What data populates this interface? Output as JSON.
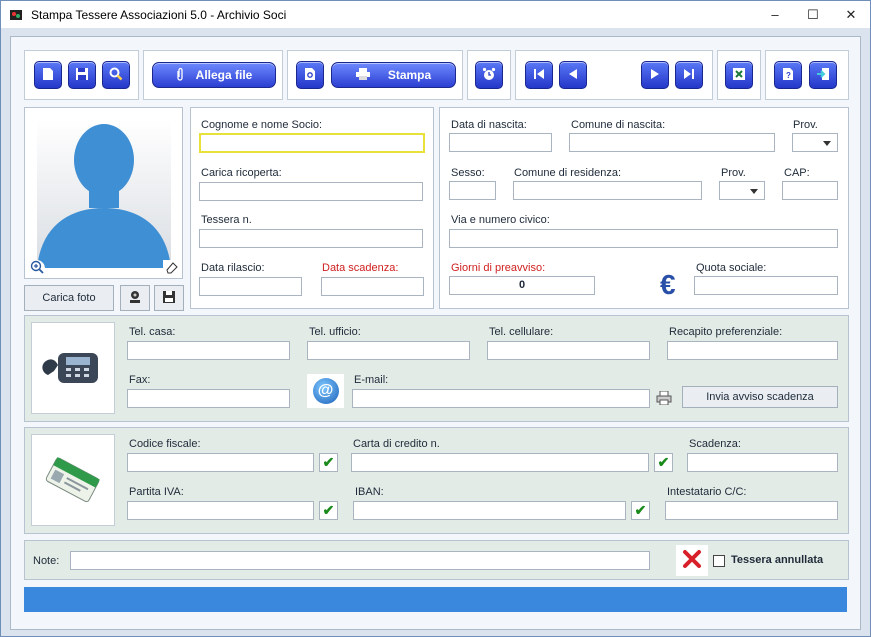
{
  "window": {
    "title": "Stampa Tessere Associazioni 5.0 - Archivio Soci",
    "minimize": "–",
    "maximize": "☐",
    "close": "✕"
  },
  "toolbar": {
    "attach_label": "Allega file",
    "print_label": "Stampa"
  },
  "photo": {
    "load_label": "Carica foto"
  },
  "fields": {
    "surname_name": "Cognome e nome Socio:",
    "role": "Carica ricoperta:",
    "card_number": "Tessera n.",
    "issue_date": "Data rilascio:",
    "expiry_date": "Data scadenza:",
    "birth_date": "Data di nascita:",
    "birth_city": "Comune di nascita:",
    "birth_prov": "Prov.",
    "sex": "Sesso:",
    "res_city": "Comune di residenza:",
    "res_prov": "Prov.",
    "cap": "CAP:",
    "address": "Via e numero civico:",
    "notice_days": "Giorni di preavviso:",
    "notice_days_value": "0",
    "fee": "Quota sociale:",
    "euro_symbol": "€"
  },
  "contacts": {
    "home": "Tel. casa:",
    "office": "Tel. ufficio:",
    "mobile": "Tel. cellulare:",
    "preferred": "Recapito preferenziale:",
    "fax": "Fax:",
    "email": "E-mail:",
    "email_symbol": "@",
    "send_notice": "Invia avviso scadenza"
  },
  "fiscal": {
    "tax_code": "Codice fiscale:",
    "credit_card": "Carta di credito n.",
    "expiry": "Scadenza:",
    "vat": "Partita IVA:",
    "iban": "IBAN:",
    "holder": "Intestatario C/C:",
    "check_mark": "✔"
  },
  "notes": {
    "label": "Note:",
    "cancelled_label": "Tessera annullata"
  }
}
